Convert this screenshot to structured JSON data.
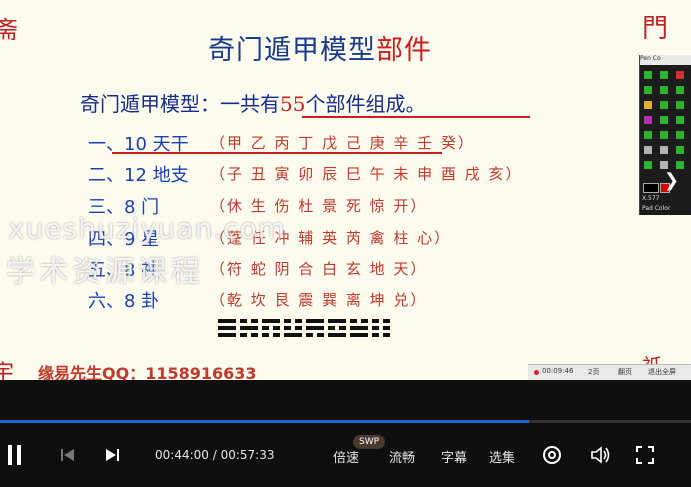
{
  "slide": {
    "title_main": "奇门遁甲模型",
    "title_accent": "部件",
    "summary_pre": "奇门遁甲模型：一共有",
    "summary_num": "55",
    "summary_post": "个部件组成。",
    "rows": [
      {
        "label": "一、10 天干",
        "items": "（甲 乙 丙 丁 戊 己 庚 辛 壬 癸）"
      },
      {
        "label": "二、12 地支",
        "items": "（子 丑 寅 卯 辰 巳 午 未 申 酉 戌 亥）"
      },
      {
        "label": "三、8 门",
        "items": "（休 生 伤 杜 景 死 惊 开）"
      },
      {
        "label": "四、9 星",
        "items": "（蓬 任 冲 辅 英 芮 禽 柱 心）"
      },
      {
        "label": "五、8 神",
        "items": "（符 蛇 阴 合 白 玄 地 天）"
      },
      {
        "label": "六、8 卦",
        "items": "（乾 坎 艮 震 巽 离 坤 兑）"
      }
    ],
    "qq": "缘易先生QQ：1158916633",
    "trigram_count": 8
  },
  "watermark": {
    "line1": "xueshuziyuan.com",
    "line2": "学术资源课程"
  },
  "tool_panel": {
    "header": "Pen Co",
    "label_a": "X.577",
    "label_b": "Pad Color"
  },
  "slide_bottom_bar": {
    "items": [
      "00:09:46",
      "2页",
      "翻页",
      "退出全屏"
    ]
  },
  "player": {
    "time_current": "00:44:00",
    "time_total": "00:57:33",
    "time_sep": " / ",
    "progress": 0.765,
    "swp_badge": "SWP",
    "speed_label": "倍速",
    "quality_label": "流畅",
    "subtitle_label": "字幕",
    "episodes_label": "选集",
    "accent_color": "#1e64d6"
  }
}
